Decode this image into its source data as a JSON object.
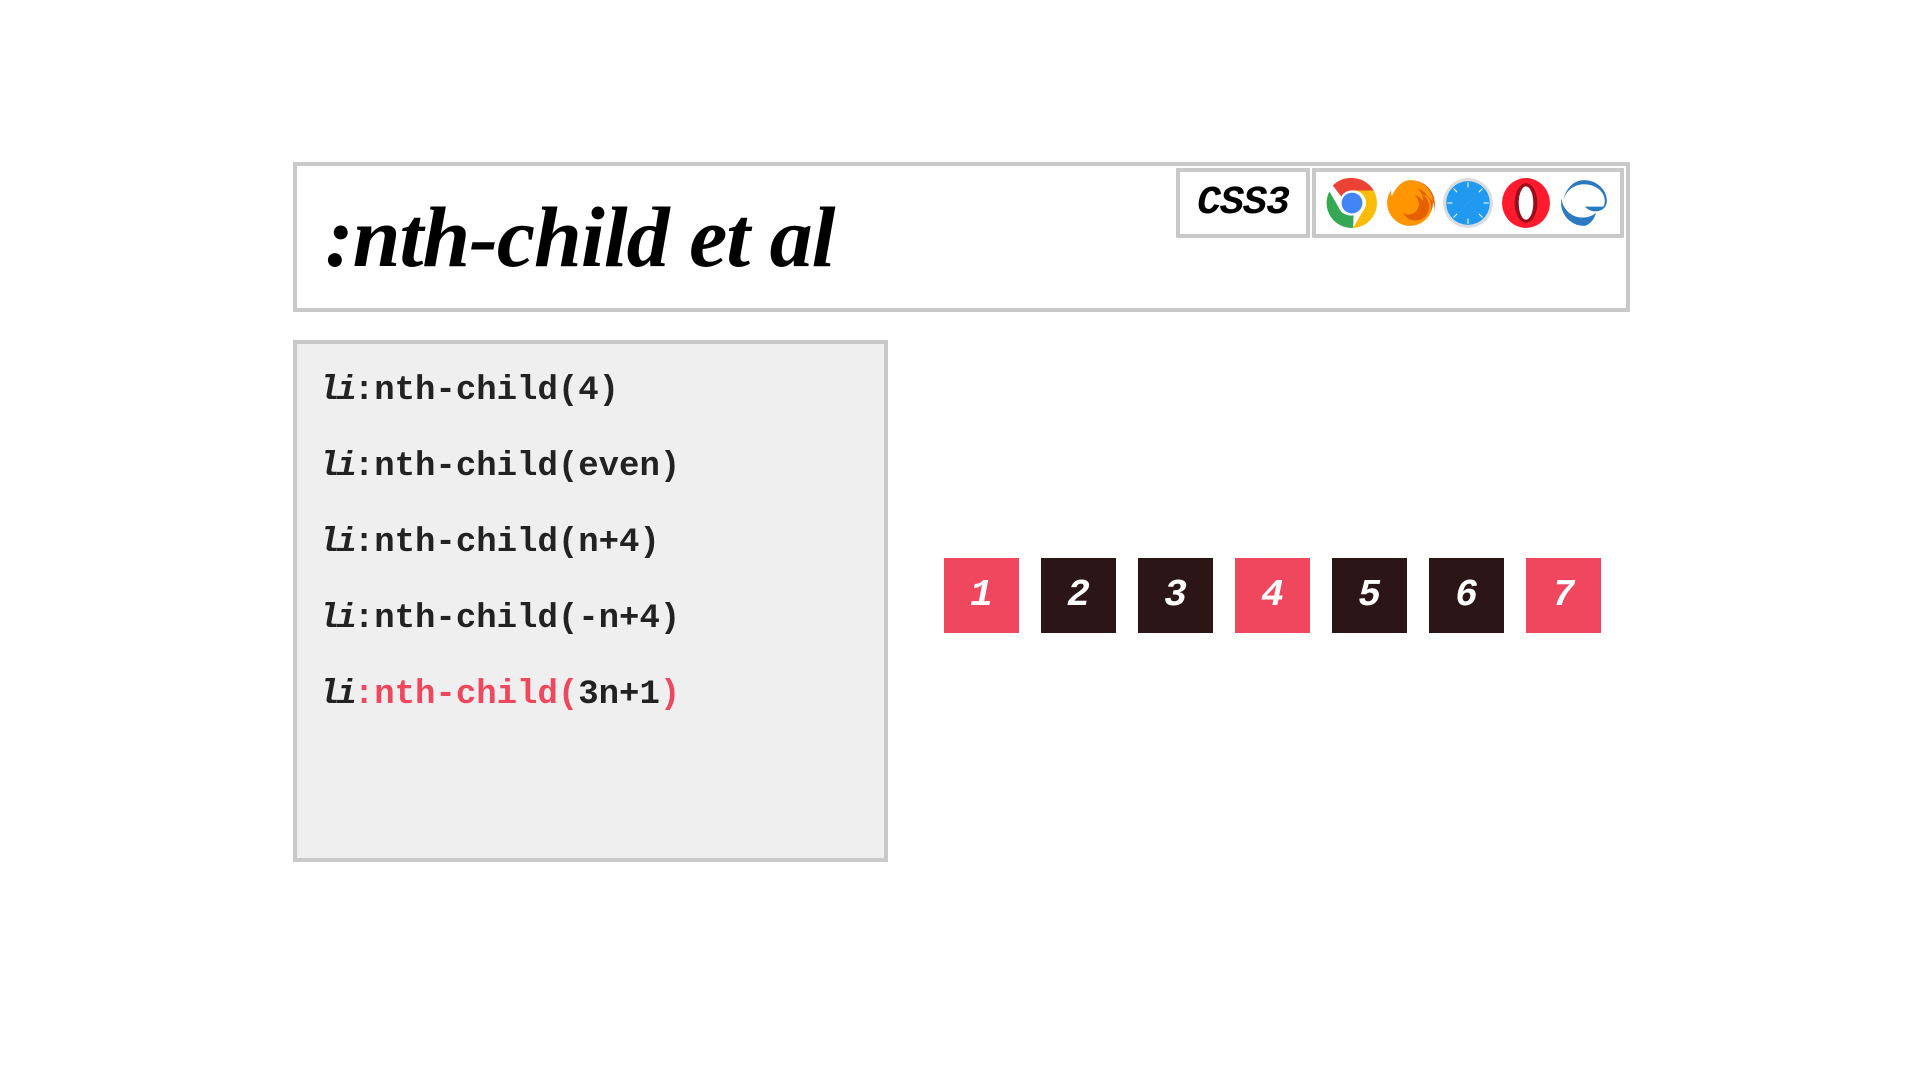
{
  "header": {
    "title": ":nth-child et al",
    "css_badge": "CSS3",
    "browsers": [
      "chrome",
      "firefox",
      "safari",
      "opera",
      "edge"
    ]
  },
  "code": {
    "lines": [
      {
        "element": "li",
        "pseudo_open": ":nth-child(",
        "arg": "4",
        "pseudo_close": ")",
        "active": false
      },
      {
        "element": "li",
        "pseudo_open": ":nth-child(",
        "arg": "even",
        "pseudo_close": ")",
        "active": false
      },
      {
        "element": "li",
        "pseudo_open": ":nth-child(",
        "arg": "n+4",
        "pseudo_close": ")",
        "active": false
      },
      {
        "element": "li",
        "pseudo_open": ":nth-child(",
        "arg": "-n+4",
        "pseudo_close": ")",
        "active": false
      },
      {
        "element": "li",
        "pseudo_open": ":nth-child(",
        "arg": "3n+1",
        "pseudo_close": ")",
        "active": true
      }
    ]
  },
  "tiles": {
    "items": [
      {
        "label": "1",
        "match": true
      },
      {
        "label": "2",
        "match": false
      },
      {
        "label": "3",
        "match": false
      },
      {
        "label": "4",
        "match": true
      },
      {
        "label": "5",
        "match": false
      },
      {
        "label": "6",
        "match": false
      },
      {
        "label": "7",
        "match": true
      }
    ]
  }
}
